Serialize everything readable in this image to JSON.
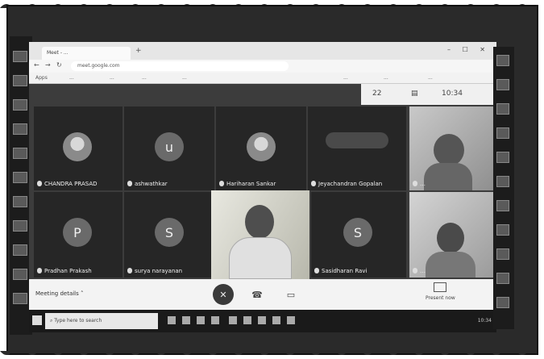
{
  "browser": {
    "tab_title": "Meet - ...",
    "url": "meet.google.com",
    "bookmarks": [
      "Apps",
      "...",
      "...",
      "...",
      "..."
    ],
    "bookmarks_right": [
      "...",
      "...",
      "..."
    ]
  },
  "meet": {
    "header": {
      "people_count": "22",
      "time": "10:34"
    },
    "participants": [
      {
        "name": "CHANDRA PRASAD",
        "initial": "",
        "kind": "photo"
      },
      {
        "name": "ashwathkar",
        "initial": "u",
        "kind": "initial"
      },
      {
        "name": "Hariharan Sankar",
        "initial": "",
        "kind": "photo"
      },
      {
        "name": "Jeyachandran Gopalan",
        "initial": "",
        "kind": "photo"
      },
      {
        "name": "…",
        "initial": "",
        "kind": "video"
      },
      {
        "name": "Pradhan Prakash",
        "initial": "P",
        "kind": "initial"
      },
      {
        "name": "surya narayanan",
        "initial": "S",
        "kind": "initial"
      },
      {
        "name": "",
        "initial": "",
        "kind": "video-main"
      },
      {
        "name": "Sasidharan Ravi",
        "initial": "S",
        "kind": "initial"
      },
      {
        "name": "…",
        "initial": "",
        "kind": "video"
      }
    ],
    "bottom": {
      "meeting_details": "Meeting details",
      "present_label": "Present now"
    }
  },
  "taskbar": {
    "search_placeholder": "Type here to search",
    "clock": "10:34"
  },
  "colors": {
    "screen_bg": "#3c3c3c",
    "tile_bg": "#262626",
    "frame": "#2a2a2a"
  },
  "icons": [
    "microphone-off-icon",
    "phone-hangup-icon",
    "camera-icon",
    "present-screen-icon",
    "people-icon",
    "chat-icon",
    "windows-start-icon",
    "search-icon"
  ]
}
